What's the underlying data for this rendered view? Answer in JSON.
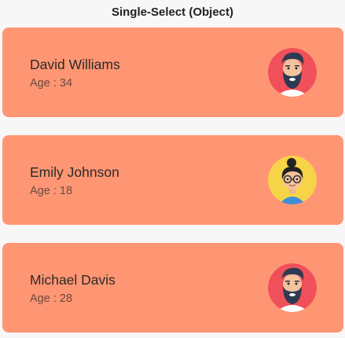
{
  "header": {
    "title": "Single-Select (Object)"
  },
  "people": [
    {
      "name": "David Williams",
      "age_text": "Age : 34",
      "avatar_icon": "bearded-man-avatar-icon"
    },
    {
      "name": "Emily Johnson",
      "age_text": "Age : 18",
      "avatar_icon": "woman-glasses-avatar-icon"
    },
    {
      "name": "Michael Davis",
      "age_text": "Age : 28",
      "avatar_icon": "bearded-man-avatar-icon"
    }
  ],
  "colors": {
    "card_background": "#ff9673",
    "page_background": "#f7f7f7",
    "avatar_red": "#f0505a",
    "avatar_yellow": "#f7d348"
  }
}
